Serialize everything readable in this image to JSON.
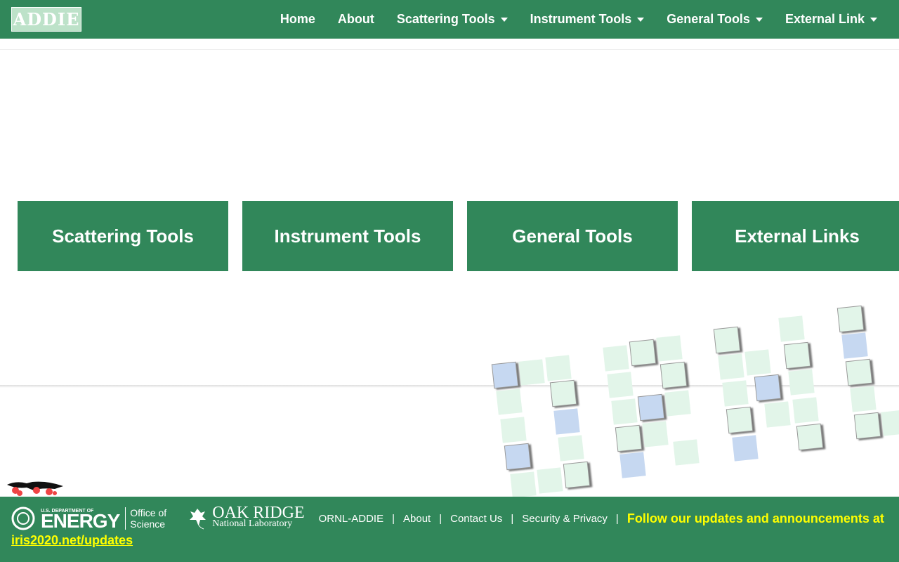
{
  "nav": {
    "logo": "ADDIE",
    "items": [
      {
        "label": "Home",
        "dropdown": false
      },
      {
        "label": "About",
        "dropdown": false
      },
      {
        "label": "Scattering Tools",
        "dropdown": true
      },
      {
        "label": "Instrument Tools",
        "dropdown": true
      },
      {
        "label": "General Tools",
        "dropdown": true
      },
      {
        "label": "External Link",
        "dropdown": true
      }
    ]
  },
  "cards": [
    "Scattering Tools",
    "Instrument Tools",
    "General Tools",
    "External Links"
  ],
  "footer": {
    "doe_top": "U.S. DEPARTMENT OF",
    "doe_main": "ENERGY",
    "doe_office": "Office of Science",
    "ornl_top": "OAK RIDGE",
    "ornl_bottom": "National Laboratory",
    "site": "ORNL-ADDIE",
    "sep": "|",
    "links": [
      "About",
      "Contact Us",
      "Security & Privacy"
    ],
    "follow": "Follow our updates and announcements at",
    "updates_link": "iris2020.net/updates"
  },
  "colors": {
    "brand": "#31875a",
    "highlight": "#ffff00"
  }
}
